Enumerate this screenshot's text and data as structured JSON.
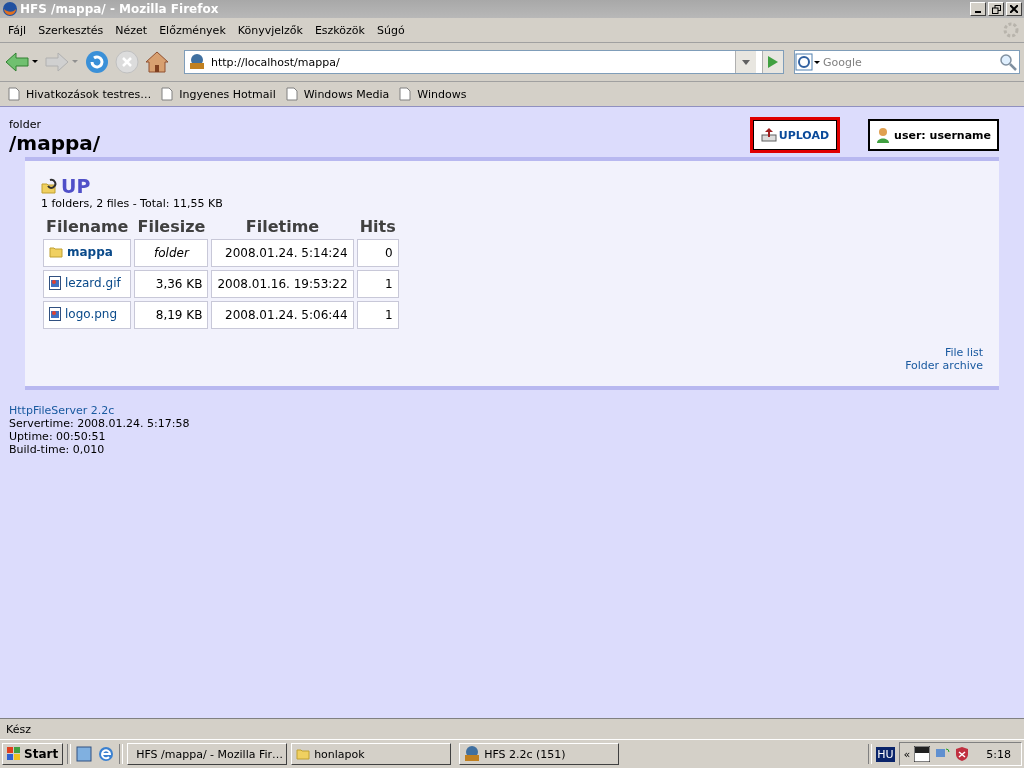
{
  "window": {
    "title": "HFS /mappa/ - Mozilla Firefox"
  },
  "menu": [
    "Fájl",
    "Szerkesztés",
    "Nézet",
    "Előzmények",
    "Könyvjelzők",
    "Eszközök",
    "Súgó"
  ],
  "address_bar": {
    "value": "http://localhost/mappa/"
  },
  "search": {
    "placeholder": "Google"
  },
  "bookmarks": [
    "Hivatkozások testres…",
    "Ingyenes Hotmail",
    "Windows Media",
    "Windows"
  ],
  "page": {
    "folder_label": "folder",
    "folder_path": "/mappa/",
    "upload": "UPLOAD",
    "user": "user: username",
    "up": "UP",
    "summary": "1 folders, 2 files - Total: 11,55 KB",
    "table": {
      "columns": [
        "Filename",
        "Filesize",
        "Filetime",
        "Hits"
      ],
      "rows": [
        {
          "kind": "folder",
          "name": "mappa",
          "size": "folder",
          "time": "2008.01.24. 5:14:24",
          "hits": "0"
        },
        {
          "kind": "file",
          "name": "lezard.gif",
          "size": "3,36 KB",
          "time": "2008.01.16. 19:53:22",
          "hits": "1"
        },
        {
          "kind": "file",
          "name": "logo.png",
          "size": "8,19 KB",
          "time": "2008.01.24. 5:06:44",
          "hits": "1"
        }
      ]
    },
    "links": [
      "File list",
      "Folder archive"
    ],
    "footer": {
      "server": "HttpFileServer 2.2c",
      "lines": [
        "Servertime: 2008.01.24. 5:17:58",
        "Uptime: 00:50:51",
        "Build-time: 0,010"
      ]
    }
  },
  "status_bar": "Kész",
  "taskbar": {
    "start": "Start",
    "tasks": [
      {
        "kind": "firefox",
        "label": "HFS /mappa/ - Mozilla Fir…"
      },
      {
        "kind": "folder",
        "label": "honlapok"
      },
      {
        "kind": "hfs",
        "label": "HFS 2.2c (151)"
      }
    ],
    "language": "HU",
    "chevron": "«",
    "clock": "5:18"
  }
}
